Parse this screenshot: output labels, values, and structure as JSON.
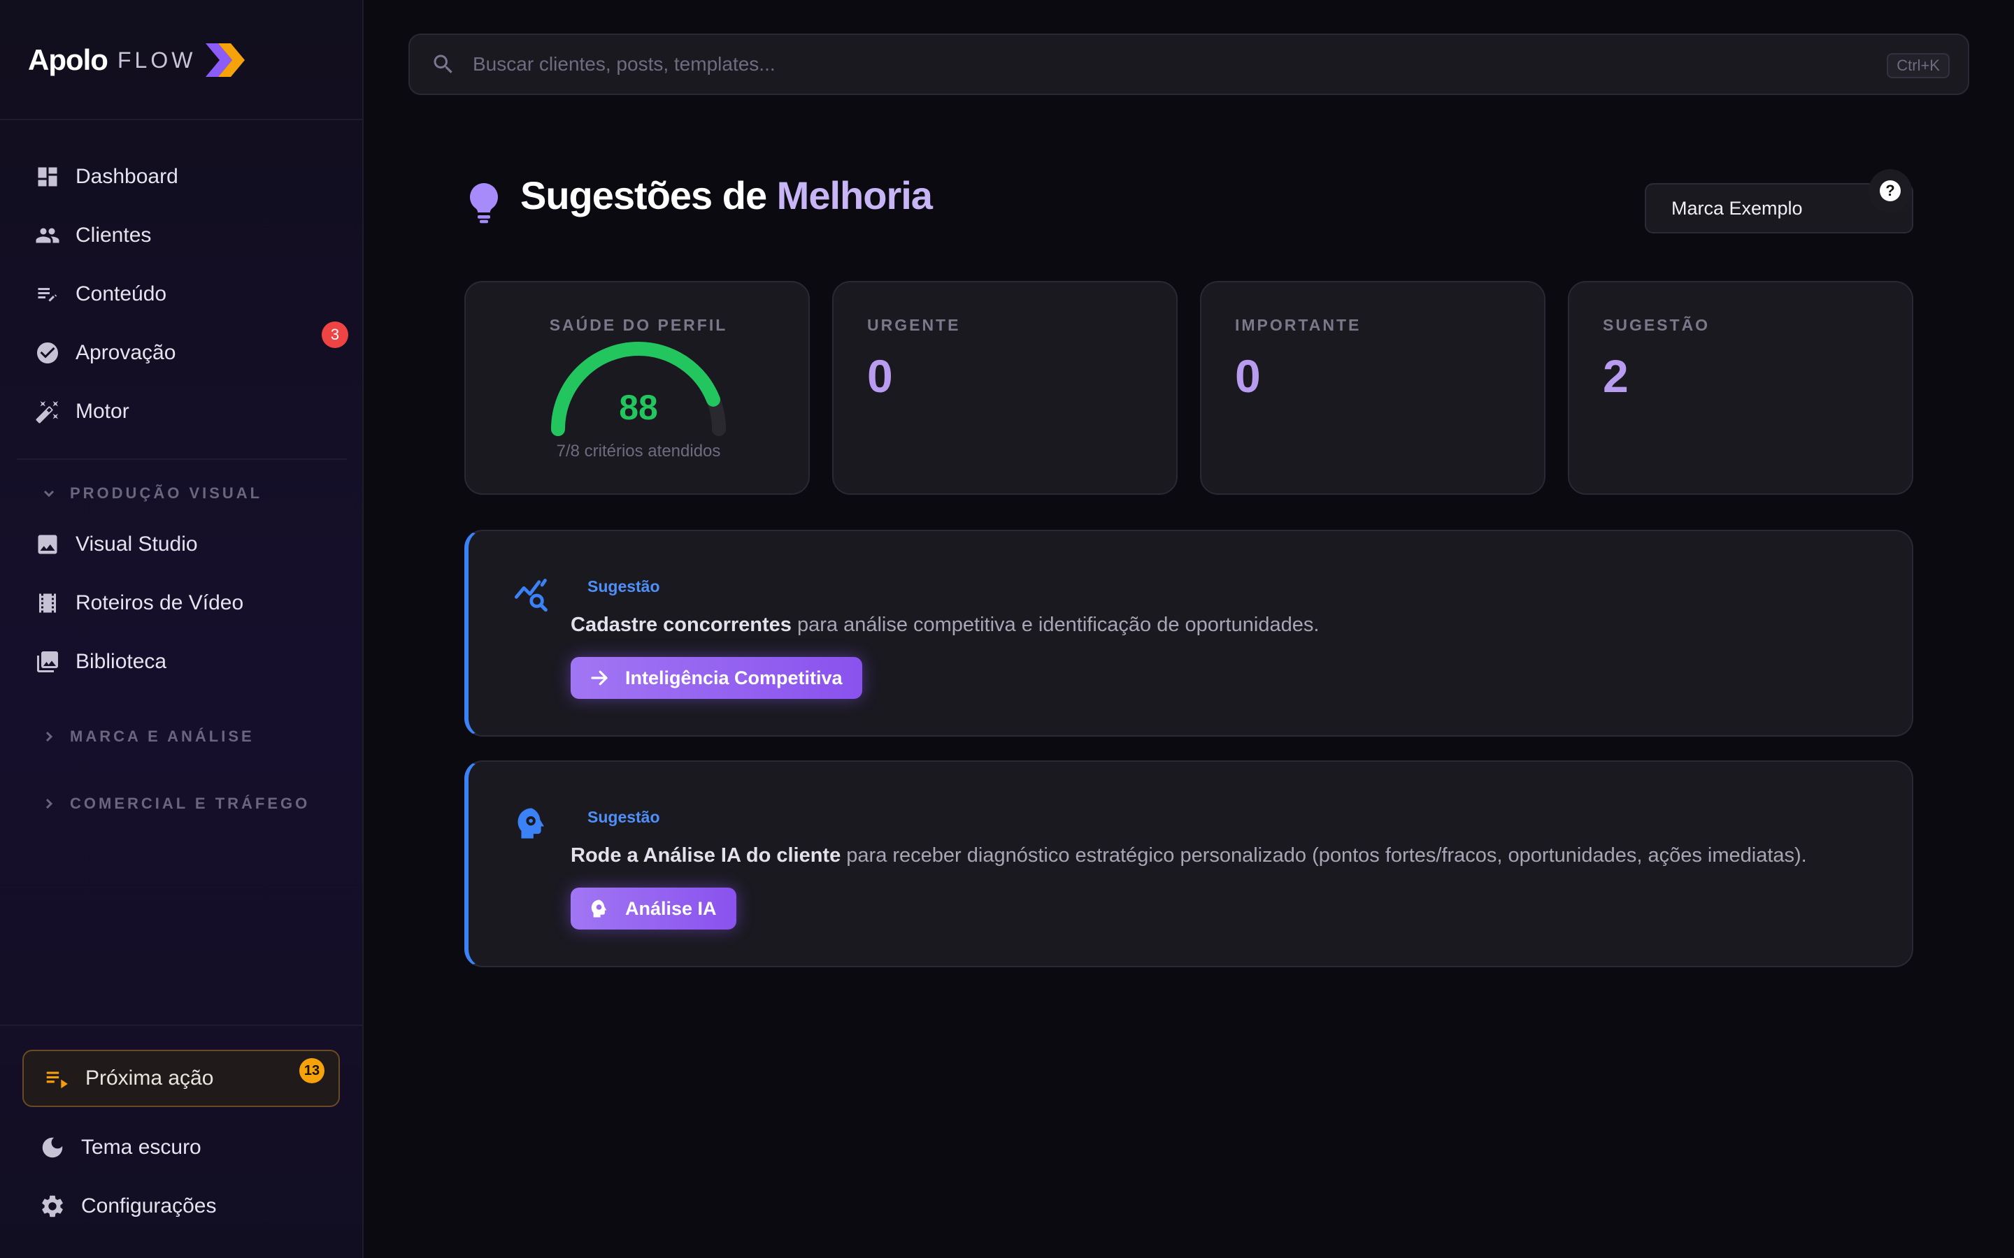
{
  "app": {
    "name_main": "Apolo",
    "name_sub": "FLOW",
    "brand_accent": "#8b5cf6",
    "logo_accent": "#f59e0b"
  },
  "sidebar": {
    "items": [
      {
        "label": "Dashboard",
        "icon": "dashboard-icon"
      },
      {
        "label": "Clientes",
        "icon": "people-icon"
      },
      {
        "label": "Conteúdo",
        "icon": "edit-list-icon"
      },
      {
        "label": "Aprovação",
        "icon": "check-circle-icon",
        "badge": "3"
      },
      {
        "label": "Motor",
        "icon": "magic-wand-icon"
      }
    ],
    "sections": [
      {
        "label": "PRODUÇÃO VISUAL",
        "expanded": true,
        "items": [
          {
            "label": "Visual Studio",
            "icon": "image-icon"
          },
          {
            "label": "Roteiros de Vídeo",
            "icon": "film-icon"
          },
          {
            "label": "Biblioteca",
            "icon": "photo-library-icon"
          }
        ]
      },
      {
        "label": "MARCA E ANÁLISE",
        "expanded": false
      },
      {
        "label": "COMERCIAL E TRÁFEGO",
        "expanded": false
      }
    ],
    "next_action": {
      "label": "Próxima ação",
      "badge": "13",
      "icon": "playlist-play-icon"
    },
    "theme": {
      "label": "Tema escuro",
      "icon": "moon-icon"
    },
    "settings": {
      "label": "Configurações",
      "icon": "gear-icon"
    }
  },
  "search": {
    "placeholder": "Buscar clientes, posts, templates...",
    "shortcut": "Ctrl+K"
  },
  "page": {
    "title_part1": "Sugestões de",
    "title_part2": "Melhoria",
    "icon": "lightbulb-icon"
  },
  "brand_select": {
    "value": "Marca Exemplo"
  },
  "help": {
    "label": "?"
  },
  "stats": {
    "health": {
      "label": "SAÚDE DO PERFIL",
      "score": "88",
      "score_fraction": 0.88,
      "subtitle": "7/8 critérios atendidos",
      "color": "#22c55e"
    },
    "urgent": {
      "label": "URGENTE",
      "value": "0"
    },
    "important": {
      "label": "IMPORTANTE",
      "value": "0"
    },
    "suggestion": {
      "label": "SUGESTÃO",
      "value": "2"
    }
  },
  "suggestions": [
    {
      "tag": "Sugestão",
      "bold": "Cadastre concorrentes",
      "rest": " para análise competitiva e identificação de oportunidades.",
      "button": "Inteligência Competitiva",
      "icon": "chart-search-icon",
      "button_icon": "arrow-right-icon"
    },
    {
      "tag": "Sugestão",
      "bold": "Rode a Análise IA do cliente",
      "rest": " para receber diagnóstico estratégico personalizado (pontos fortes/fracos, oportunidades, ações imediatas).",
      "button": "Análise IA",
      "icon": "head-gear-icon",
      "button_icon": "head-gear-icon"
    }
  ]
}
